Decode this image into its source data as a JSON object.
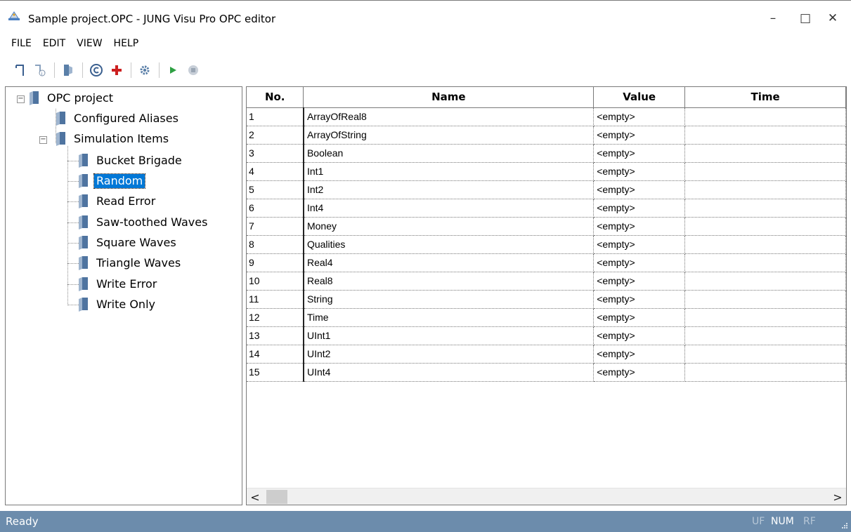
{
  "window": {
    "title": "Sample project.OPC - JUNG Visu Pro OPC editor",
    "app_icon": "app-logo-icon",
    "minimize_glyph": "–",
    "maximize_glyph": "□",
    "close_glyph": "✕"
  },
  "menu": [
    "FILE",
    "EDIT",
    "VIEW",
    "HELP"
  ],
  "toolbar": {
    "icons": [
      "new-item-icon",
      "item-info-icon",
      "exit-door-icon",
      "copyright-icon",
      "add-red-cross-icon",
      "settings-gear-icon",
      "play-icon",
      "stop-icon"
    ]
  },
  "tree": {
    "root": "OPC project",
    "configured_aliases": "Configured Aliases",
    "simulation_items": "Simulation Items",
    "children": [
      "Bucket Brigade",
      "Random",
      "Read Error",
      "Saw-toothed Waves",
      "Square Waves",
      "Triangle Waves",
      "Write Error",
      "Write Only"
    ],
    "selected": "Random"
  },
  "grid": {
    "columns": [
      "No.",
      "Name",
      "Value",
      "Time"
    ],
    "rows": [
      {
        "no": "1",
        "name": "ArrayOfReal8",
        "value": "<empty>",
        "time": ""
      },
      {
        "no": "2",
        "name": "ArrayOfString",
        "value": "<empty>",
        "time": ""
      },
      {
        "no": "3",
        "name": "Boolean",
        "value": "<empty>",
        "time": ""
      },
      {
        "no": "4",
        "name": "Int1",
        "value": "<empty>",
        "time": ""
      },
      {
        "no": "5",
        "name": "Int2",
        "value": "<empty>",
        "time": ""
      },
      {
        "no": "6",
        "name": "Int4",
        "value": "<empty>",
        "time": ""
      },
      {
        "no": "7",
        "name": "Money",
        "value": "<empty>",
        "time": ""
      },
      {
        "no": "8",
        "name": "Qualities",
        "value": "<empty>",
        "time": ""
      },
      {
        "no": "9",
        "name": "Real4",
        "value": "<empty>",
        "time": ""
      },
      {
        "no": "10",
        "name": "Real8",
        "value": "<empty>",
        "time": ""
      },
      {
        "no": "11",
        "name": "String",
        "value": "<empty>",
        "time": ""
      },
      {
        "no": "12",
        "name": "Time",
        "value": "<empty>",
        "time": ""
      },
      {
        "no": "13",
        "name": "UInt1",
        "value": "<empty>",
        "time": ""
      },
      {
        "no": "14",
        "name": "UInt2",
        "value": "<empty>",
        "time": ""
      },
      {
        "no": "15",
        "name": "UInt4",
        "value": "<empty>",
        "time": ""
      }
    ]
  },
  "scrollbar": {
    "left_arrow": "<",
    "right_arrow": ">"
  },
  "status": {
    "text": "Ready",
    "indicators": {
      "uf": "UF",
      "num": "NUM",
      "rf": "RF"
    }
  },
  "colors": {
    "selection": "#0078d7",
    "statusbar": "#6c8cac",
    "play_green": "#2ea043",
    "cross_red": "#cc1f1f"
  }
}
